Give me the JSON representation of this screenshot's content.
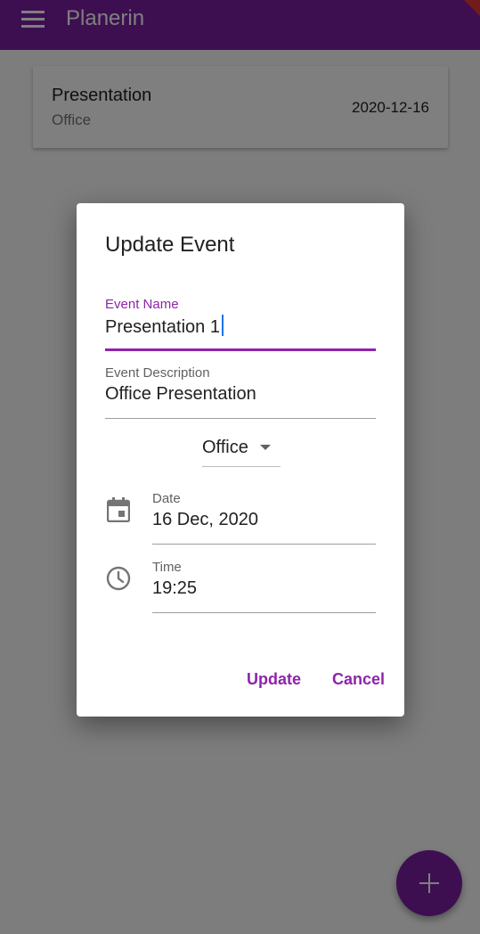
{
  "app": {
    "title": "Planerin"
  },
  "events": [
    {
      "title": "Presentation",
      "category": "Office",
      "date": "2020-12-16"
    }
  ],
  "dialog": {
    "title": "Update Event",
    "event_name": {
      "label": "Event Name",
      "value": "Presentation 1"
    },
    "event_description": {
      "label": "Event Description",
      "value": "Office Presentation"
    },
    "category": {
      "selected": "Office"
    },
    "date": {
      "label": "Date",
      "value": "16 Dec, 2020"
    },
    "time": {
      "label": "Time",
      "value": "19:25"
    },
    "buttons": {
      "update": "Update",
      "cancel": "Cancel"
    }
  },
  "colors": {
    "primary": "#7b1fa2",
    "accent": "#8e24aa"
  },
  "icons": [
    "menu-icon",
    "calendar-icon",
    "clock-icon",
    "add-icon"
  ]
}
